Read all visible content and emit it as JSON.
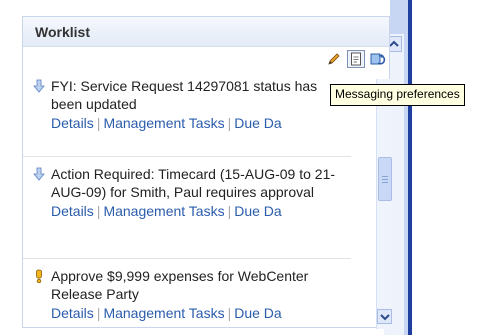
{
  "panel": {
    "title": "Worklist"
  },
  "tooltip": {
    "text": "Messaging preferences"
  },
  "items": [
    {
      "icon": "info-arrow-icon",
      "text": "FYI: Service Request 14297081 status has been updated",
      "links": [
        "Details",
        "Management Tasks",
        "Due Da"
      ]
    },
    {
      "icon": "info-arrow-icon",
      "text": "Action Required: Timecard (15-AUG-09 to 21-AUG-09) for Smith, Paul requires approval",
      "links": [
        "Details",
        "Management Tasks",
        "Due Da"
      ]
    },
    {
      "icon": "priority-exclamation-icon",
      "text": "Approve $9,999 expenses for WebCenter Release Party",
      "links": [
        "Details",
        "Management Tasks",
        "Due Da"
      ]
    }
  ],
  "colors": {
    "link": "#2a5cac",
    "frame": "#1f3f9e",
    "tooltip_bg": "#ffffe1"
  }
}
